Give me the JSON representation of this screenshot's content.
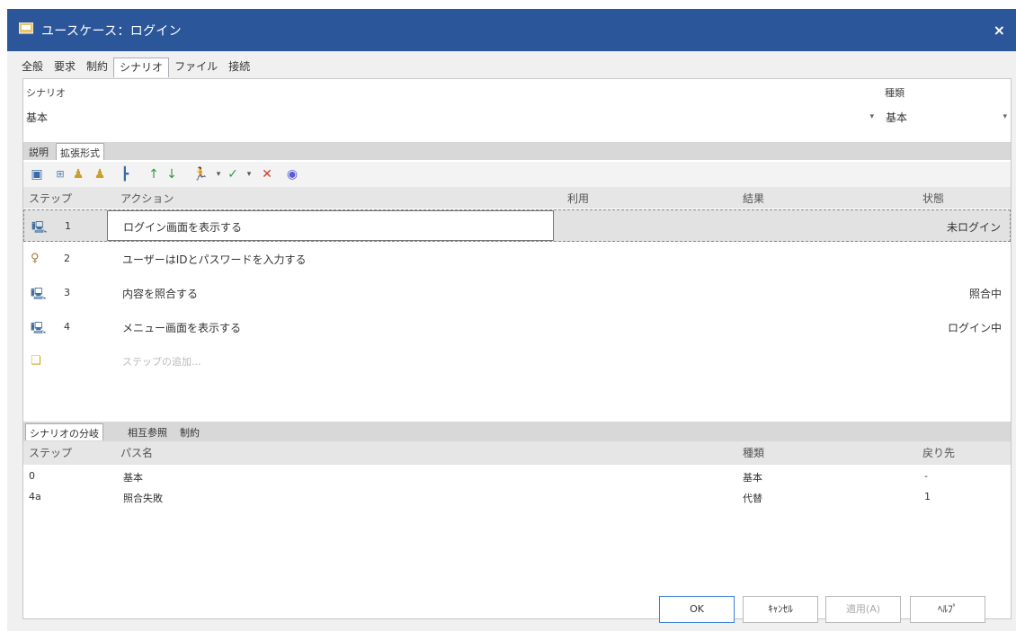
{
  "window": {
    "title": "ユースケース：ログイン",
    "close_label": "×"
  },
  "top_tabs": [
    "全般",
    "要求",
    "制約",
    "シナリオ",
    "ファイル",
    "接続"
  ],
  "top_tab_active": 3,
  "scenario": {
    "label": "シナリオ",
    "value": "基本"
  },
  "kind": {
    "label": "種類",
    "value": "基本"
  },
  "sub_tabs": [
    "説明",
    "拡張形式"
  ],
  "sub_tab_active": 1,
  "toolbar_icons": [
    "save-icon",
    "structure-icon",
    "add-user-icon",
    "remove-user-icon",
    "hierarchy-icon",
    "move-up-icon",
    "move-down-icon",
    "actor-icon",
    "check-icon",
    "delete-icon",
    "circle-icon"
  ],
  "steps_header": {
    "step": "ステップ",
    "action": "アクション",
    "uses": "利用",
    "result": "結果",
    "state": "状態"
  },
  "steps": [
    {
      "num": "1",
      "actor": "system",
      "action": "ログイン画面を表示する",
      "state": "未ログイン"
    },
    {
      "num": "2",
      "actor": "user",
      "action": "ユーザーはIDとパスワードを入力する",
      "state": ""
    },
    {
      "num": "3",
      "actor": "system",
      "action": "内容を照合する",
      "state": "照合中"
    },
    {
      "num": "4",
      "actor": "system",
      "action": "メニュー画面を表示する",
      "state": "ログイン中"
    }
  ],
  "add_step_placeholder": "ステップの追加...",
  "bottom_tabs": [
    "シナリオの分岐",
    "相互参照",
    "制約"
  ],
  "bottom_tab_active": 0,
  "paths_header": {
    "step": "ステップ",
    "path": "パス名",
    "kind": "種類",
    "return": "戻り先"
  },
  "paths": [
    {
      "step": "0",
      "path": "基本",
      "kind": "基本",
      "return": "-"
    },
    {
      "step": "4a",
      "path": "照合失敗",
      "kind": "代替",
      "return": "1"
    }
  ],
  "buttons": {
    "ok": "OK",
    "cancel": "ｷｬﾝｾﾙ",
    "apply": "適用(A)",
    "help": "ﾍﾙﾌﾟ"
  },
  "colors": {
    "titlebar": "#2b579a",
    "selected_row": "#e2e2e2",
    "header_bg": "#e6e6e6"
  }
}
